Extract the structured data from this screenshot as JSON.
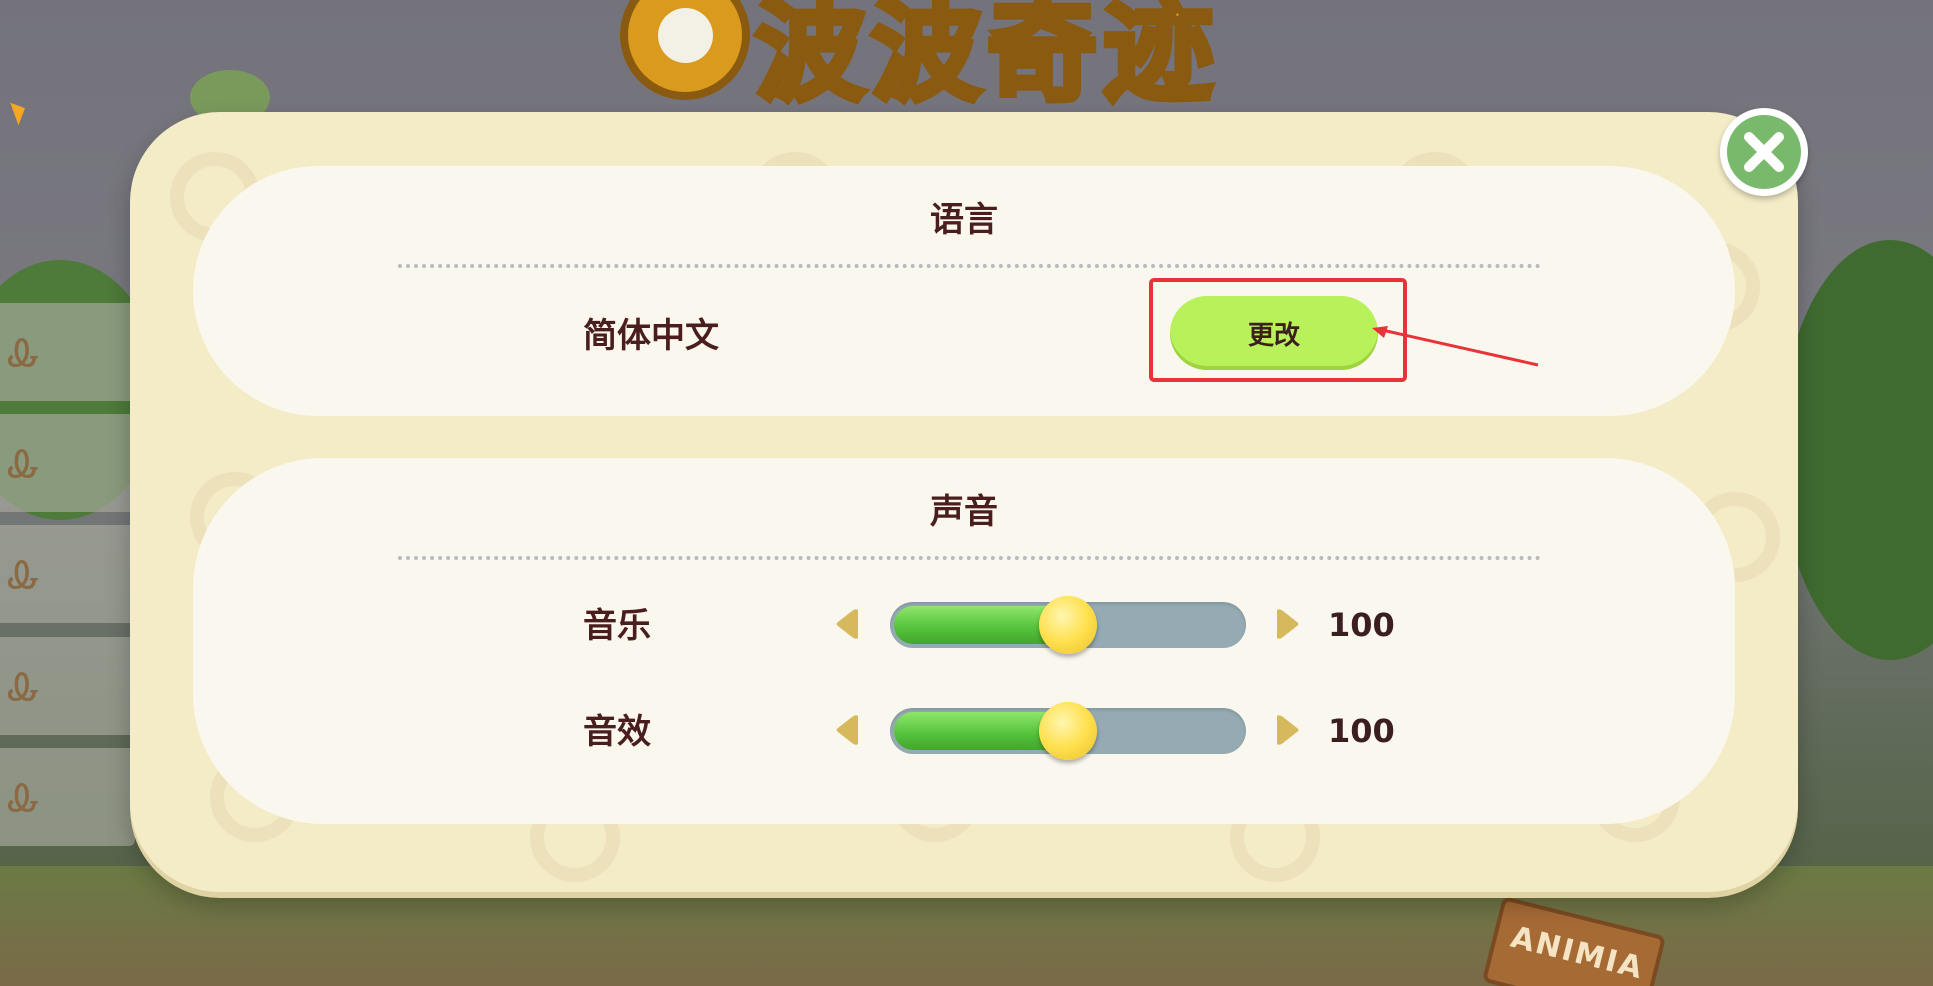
{
  "logo": {
    "text": "波波奇迹"
  },
  "language_section": {
    "title": "语言",
    "current_language": "简体中文",
    "change_label": "更改"
  },
  "sound_section": {
    "title": "声音",
    "music": {
      "label": "音乐",
      "value": "100",
      "level": 0.5
    },
    "sfx": {
      "label": "音效",
      "value": "100",
      "level": 0.5
    }
  },
  "background": {
    "sign_text": "ANIMIA"
  },
  "icons": {
    "close": "close-icon",
    "decrease": "left-arrow-icon",
    "increase": "right-arrow-icon",
    "side_tab": "rabbit-icon"
  },
  "colors": {
    "accent_green": "#b8f15a",
    "slider_fill": "#53c13a",
    "close_green": "#79b96b",
    "highlight_red": "#e8333b",
    "text_dark": "#4a1e1e"
  }
}
